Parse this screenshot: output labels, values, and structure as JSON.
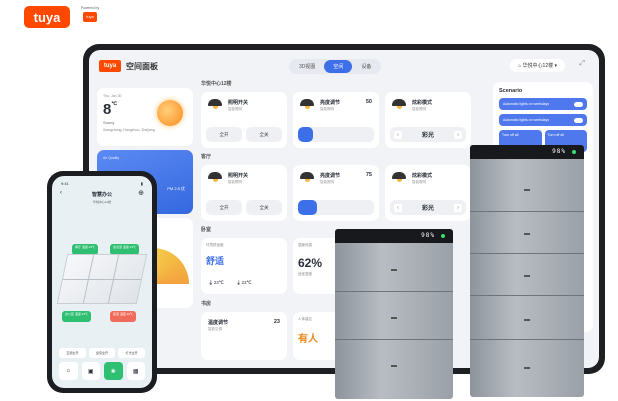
{
  "brand": {
    "logo_text": "tuya",
    "powered_by": "Powered by",
    "powered_logo": "tuya",
    "accent": "#ff4800"
  },
  "tablet": {
    "app_badge": "tuya",
    "app_title": "空间面板",
    "view_tabs": [
      "3D视图",
      "空间",
      "设备"
    ],
    "active_tab": "空间",
    "home_select": "华悦中心12楼",
    "weather": {
      "date": "Thu, Jan 30",
      "temp": "8",
      "unit": "℃",
      "condition": "Sunny",
      "location": "Xiangzhong, Hangzhou, Zhejiang"
    },
    "air": {
      "label": "Air Quality",
      "value": "34",
      "sub": "PM 2.5 优"
    },
    "gauge_label": "Season: 最舒适",
    "sections": [
      "华悦中心12楼",
      "客厅",
      "卧室",
      "书房"
    ],
    "devices_row1": [
      {
        "name": "照明开关",
        "sub": "智能照明",
        "value": "",
        "control": "buttons",
        "btn1": "全开",
        "btn2": "全关"
      },
      {
        "name": "亮度调节",
        "sub": "智能照明",
        "value": "50",
        "control": "slider",
        "level": 0.2
      },
      {
        "name": "炫彩模式",
        "sub": "智能照明",
        "value": "",
        "control": "mode",
        "mode": "彩光"
      }
    ],
    "devices_row2": [
      {
        "name": "照明开关",
        "sub": "智能照明",
        "value": "",
        "control": "buttons",
        "btn1": "全开",
        "btn2": "全关"
      },
      {
        "name": "亮度调节",
        "sub": "智能照明",
        "value": "75",
        "control": "slider",
        "level": 0.25
      },
      {
        "name": "炫彩模式",
        "sub": "智能照明",
        "value": "",
        "control": "mode",
        "mode": "彩光"
      }
    ],
    "comfort": {
      "label": "环境舒适度",
      "value": "舒适",
      "temp1": "23",
      "temp2": "23",
      "unit": "℃"
    },
    "humidity": {
      "label": "湿度传感",
      "value": "62%",
      "sub": "适宜湿度"
    },
    "temp_control": {
      "name": "温度调节",
      "sub": "智能空调",
      "value": "23"
    },
    "presence": {
      "label": "人体感应",
      "value": "有人"
    },
    "scenario": {
      "title": "Scenario",
      "items": [
        "Automatic lights on weekdays",
        "Automatic lights on weekdays"
      ],
      "grid": [
        "Turn off all",
        "Turn off all"
      ]
    }
  },
  "phone": {
    "time": "9:41",
    "title": "智慧办公",
    "subtitle": "华悦中心12楼",
    "tiles": [
      "空调全开",
      "窗帘全开",
      "灯光全开"
    ],
    "tags_green": [
      "客厅 温度 23℃",
      "会议室 温度 23℃",
      "办公区 温度 23℃"
    ],
    "tags_red": [
      "卧室 温度 26℃"
    ]
  },
  "batteries": {
    "display": "98%",
    "display_small": "98%"
  }
}
